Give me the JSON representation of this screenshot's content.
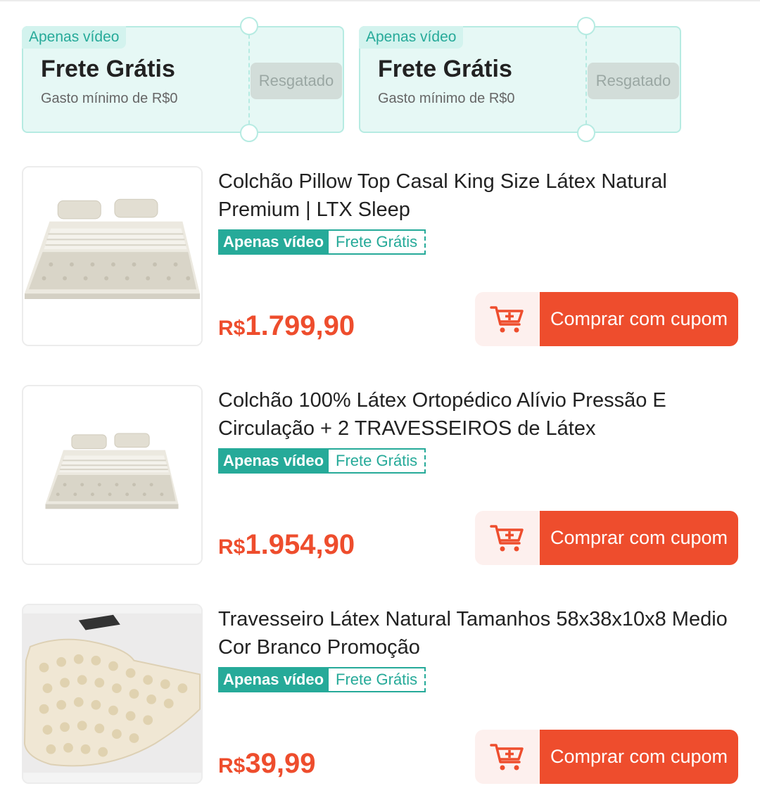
{
  "coupons": [
    {
      "tag": "Apenas vídeo",
      "title": "Frete Grátis",
      "subtitle": "Gasto mínimo de R$0",
      "button": "Resgatado"
    },
    {
      "tag": "Apenas vídeo",
      "title": "Frete Grátis",
      "subtitle": "Gasto mínimo de R$0",
      "button": "Resgatado"
    }
  ],
  "products": [
    {
      "title": "Colchão Pillow Top Casal King Size Látex Natural Premium | LTX Sleep",
      "badge_video": "Apenas vídeo",
      "badge_shipping": "Frete Grátis",
      "currency": "R$",
      "price": "1.799,90",
      "buy_label": "Comprar com cupom"
    },
    {
      "title": "Colchão 100% Látex Ortopédico Alívio Pressão E Circulação + 2 TRAVESSEIROS de Látex",
      "badge_video": "Apenas vídeo",
      "badge_shipping": "Frete Grátis",
      "currency": "R$",
      "price": "1.954,90",
      "buy_label": "Comprar com cupom"
    },
    {
      "title": "Travesseiro Látex Natural Tamanhos 58x38x10x8 Medio Cor Branco Promoção",
      "badge_video": "Apenas vídeo",
      "badge_shipping": "Frete Grátis",
      "currency": "R$",
      "price": "39,99",
      "buy_label": "Comprar com cupom"
    }
  ],
  "colors": {
    "brand": "#ee4d2d",
    "accent": "#26aa99"
  },
  "icons": {
    "cart": "add-to-cart-icon"
  }
}
